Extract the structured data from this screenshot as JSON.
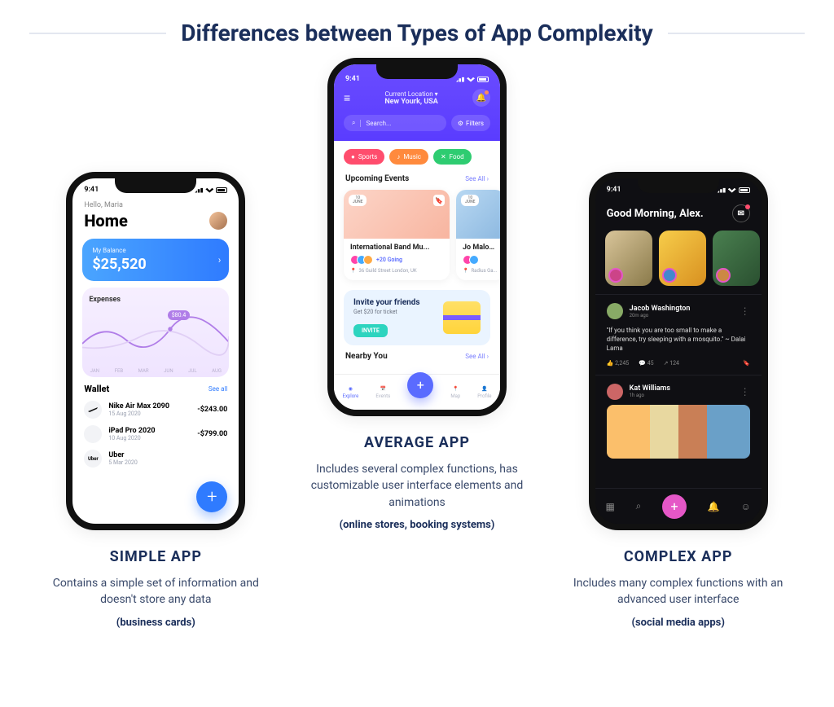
{
  "title": "Differences between Types of App Complexity",
  "simple": {
    "heading": "SIMPLE APP",
    "desc": "Contains a simple set of information and doesn't store any data",
    "examples": "(business cards)",
    "status_time": "9:41",
    "greeting": "Hello, Maria",
    "home": "Home",
    "balance_label": "My Balance",
    "balance_amount": "$25,520",
    "expenses_label": "Expenses",
    "expenses_tag": "$80.4",
    "months": [
      "JAN",
      "FEB",
      "MAR",
      "JUN",
      "JUL",
      "AUG"
    ],
    "wallet_label": "Wallet",
    "see_all": "See all",
    "items": [
      {
        "icon": "✔",
        "name": "Nike Air Max 2090",
        "date": "15 Aug 2020",
        "price": "-$243.00"
      },
      {
        "icon": "",
        "name": "iPad Pro 2020",
        "date": "10 Aug 2020",
        "price": "-$799.00"
      },
      {
        "icon": "Uber",
        "name": "Uber",
        "date": "5 Mar 2020",
        "price": ""
      }
    ]
  },
  "average": {
    "heading": "AVERAGE APP",
    "desc": "Includes several complex functions, has customizable user interface elements and animations",
    "examples": "(online stores, booking systems)",
    "status_time": "9:41",
    "loc_label": "Current Location ▾",
    "loc_value": "New Yourk, USA",
    "search_placeholder": "Search...",
    "filters": "Filters",
    "chips": [
      {
        "icon": "●",
        "label": "Sports",
        "cls": "red"
      },
      {
        "icon": "♪",
        "label": "Music",
        "cls": "org"
      },
      {
        "icon": "✕",
        "label": "Food",
        "cls": "grn"
      }
    ],
    "upcoming": "Upcoming Events",
    "see_all": "See All ›",
    "card1": {
      "day": "10",
      "mon": "JUNE",
      "name": "International Band Mu...",
      "going": "+20 Going",
      "loc": "36 Guild Street London, UK"
    },
    "card2": {
      "day": "10",
      "mon": "JUNE",
      "name": "Jo Malon...",
      "going": "",
      "loc": "Radius Ga..."
    },
    "invite_title": "Invite your friends",
    "invite_sub": "Get $20 for ticket",
    "invite_btn": "INVITE",
    "nearby": "Nearby You",
    "tabs": [
      "Explore",
      "Events",
      "Map",
      "Profile"
    ]
  },
  "complex": {
    "heading": "COMPLEX APP",
    "desc": "Includes many complex functions with an advanced user interface",
    "examples": "(social media apps)",
    "status_time": "9:41",
    "greeting": "Good Morning, Alex.",
    "post1": {
      "name": "Jacob Washington",
      "time": "20m ago",
      "quote": "\"If you think you are too small to make a difference, try sleeping with a mosquito.\" \n~ Dalai Lama",
      "likes": "2,245",
      "comments": "45",
      "shares": "124"
    },
    "post2": {
      "name": "Kat Williams",
      "time": "1h ago"
    }
  }
}
